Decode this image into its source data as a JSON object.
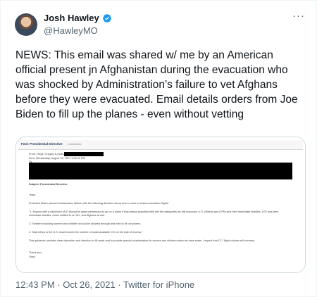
{
  "author": {
    "name": "Josh Hawley",
    "handle": "@HawleyMO"
  },
  "icons": {
    "verified": "verified-badge-icon",
    "more": "more-options-icon"
  },
  "colors": {
    "verified": "#1d9bf0",
    "text_secondary": "#536471",
    "border": "#cfd9de"
  },
  "tweet": {
    "text": "NEWS: This email was shared w/ me by an American official present jn Afghanistan during the evacuation who was shocked by Administration’s failure to vet Afghans before they were evacuated. Email details orders from Joe Biden to fill up the planes - even without vetting"
  },
  "email": {
    "title": "Fwd: Presidential Directive",
    "tag": "Unclassified",
    "from": "From: Floyd, Gregory A (Kabul)",
    "sent": "Sent: Wednesday, August 18, 2021 1:06:41 PM",
    "to": "To:",
    "subject": "Subject: Presidential Directive",
    "salutation": "Team,",
    "p1": "President Biden phoned Ambassador Wilson with the following directive about who to clear to board evacuation flights:",
    "p2": "\"1. Anyone with a valid form of ID should be given permission to go on a plane if that person plausibly falls into the categories we will evacuate: U.S. citizens and LPRs plus their immediate families, LES plus their immediate families, those entitled to an SIV, and Afghans at risk.",
    "p3": "2. Families including women and children should be allowed through and held to fill out planes.",
    "p4": "3. Total inflow to the U.S. must exceed the number of seats available. Err on the side of excess.\"",
    "p5": "This guidance provides clear discretion and direction to fill seats and to provide special consideration for women and children when we have seats. I expect that C17 flight volume will increase.",
    "closing": "Thank you,",
    "signature": "Greg"
  },
  "footer": {
    "time": "12:43 PM",
    "separator1": " · ",
    "date": "Oct 26, 2021",
    "separator2": " · ",
    "source": "Twitter for iPhone"
  }
}
